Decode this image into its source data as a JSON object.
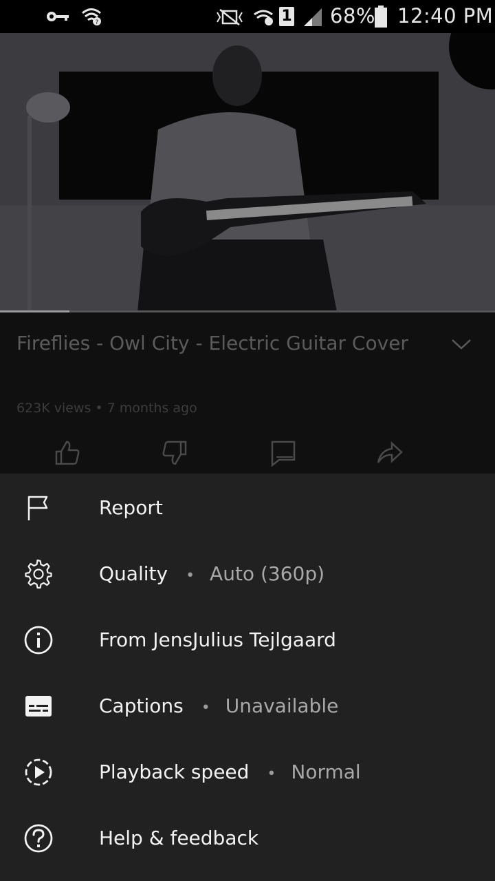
{
  "status_bar": {
    "battery": "68%",
    "time": "12:40 PM",
    "sim_slot": "1",
    "icons": [
      "vpn-key-icon",
      "wifi-icon",
      "mute-icon",
      "wifi-calling-icon",
      "sim-icon",
      "signal-icon",
      "battery-icon"
    ]
  },
  "video": {
    "progress_fraction": 0.14,
    "title": "Fireflies - Owl City - Electric Guitar Cover",
    "views": "623K views",
    "age": "7 months ago",
    "actions": [
      "like-icon",
      "dislike-icon",
      "comment-icon",
      "share-icon"
    ]
  },
  "menu": {
    "items": [
      {
        "label": "Report",
        "icon": "flag-icon"
      },
      {
        "label": "Quality",
        "separator": "•",
        "value": "Auto (360p)",
        "icon": "gear-icon"
      },
      {
        "label": "From JensJulius Tejlgaard",
        "icon": "info-icon"
      },
      {
        "label": "Captions",
        "separator": "•",
        "value": "Unavailable",
        "icon": "captions-icon"
      },
      {
        "label": "Playback speed",
        "separator": "•",
        "value": "Normal",
        "icon": "playback-speed-icon"
      },
      {
        "label": "Help & feedback",
        "icon": "help-icon"
      }
    ]
  },
  "colors": {
    "sheet_background": "#212121",
    "dimmed_background": "#101010",
    "menu_text": "#f2f2f2",
    "value_text": "#a8a8a8"
  }
}
